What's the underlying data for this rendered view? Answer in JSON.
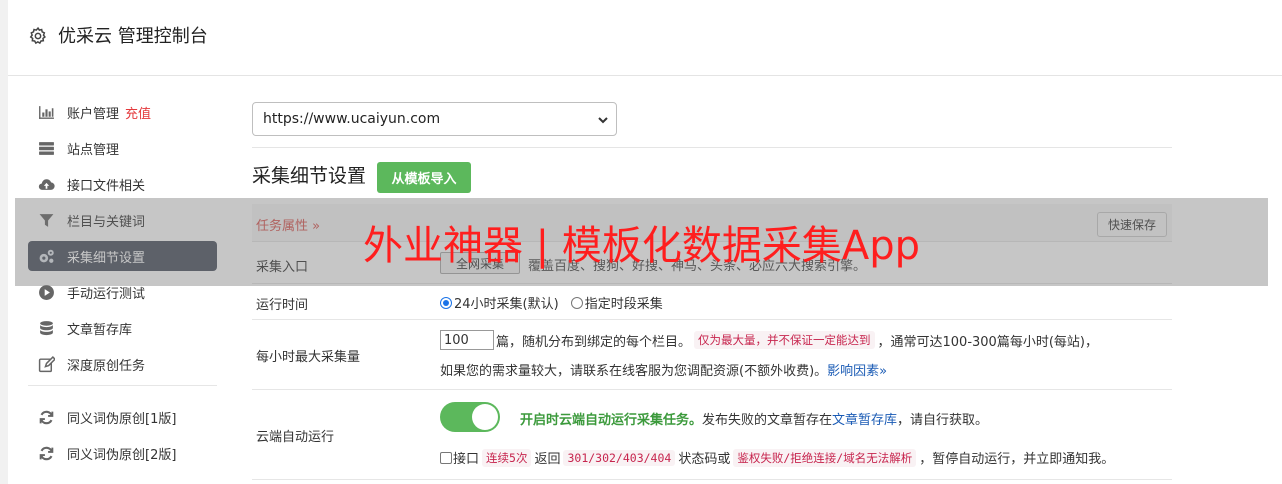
{
  "header": {
    "title": "优采云 管理控制台",
    "icon": "gear-icon"
  },
  "sidebar": {
    "items": [
      {
        "label": "账户管理",
        "extra": "充值",
        "icon": "bar-chart-icon"
      },
      {
        "label": "站点管理",
        "icon": "server-icon"
      },
      {
        "label": "接口文件相关",
        "icon": "cloud-upload-icon"
      },
      {
        "label": "栏目与关键词",
        "icon": "filter-icon"
      },
      {
        "label": "采集细节设置",
        "icon": "cogs-icon",
        "active": true
      },
      {
        "label": "手动运行测试",
        "icon": "play-circle-icon"
      },
      {
        "label": "文章暂存库",
        "icon": "database-icon"
      },
      {
        "label": "深度原创任务",
        "icon": "edit-icon"
      },
      {
        "label": "同义词伪原创[1版]",
        "icon": "refresh-icon"
      },
      {
        "label": "同义词伪原创[2版]",
        "icon": "refresh-icon"
      }
    ]
  },
  "site_select": {
    "value": "https://www.ucaiyun.com"
  },
  "section": {
    "title": "采集细节设置",
    "import_button": "从模板导入"
  },
  "task_row": {
    "label": "任务属性 »",
    "quick_save": "快速保存"
  },
  "entry_row": {
    "label": "采集入口",
    "button": "全网采集",
    "note": "覆盖百度、搜狗、好搜、神马、头条、必应六大搜索引擎。"
  },
  "runtime_row": {
    "label": "运行时间",
    "option1": "24小时采集(默认)",
    "option2": "指定时段采集"
  },
  "rate_row": {
    "label": "每小时最大采集量",
    "value": "100",
    "text1": "篇，随机分布到绑定的每个栏目。",
    "code": "仅为最大量，并不保证一定能达到",
    "text2": "，通常可达100-300篇每小时(每站)，",
    "line2": "如果您的需求量较大，请联系在线客服为您调配资源(不额外收费)。",
    "link": "影响因素",
    "link_suffix": "»"
  },
  "cloud_row": {
    "label": "云端自动运行",
    "green_text": "开启时云端自动运行采集任务。",
    "text_a": "发布失败的文章暂存在",
    "link": "文章暂存库",
    "text_b": "，请自行获取。",
    "l2_a": "接口",
    "code1": "连续5次",
    "l2_b": "返回",
    "code2": "301/302/403/404",
    "l2_c": "状态码或",
    "code3": "鉴权失败/拒绝连接/域名无法解析",
    "l2_d": "，暂停自动运行，并立即通知我。"
  },
  "overlay": {
    "text": "外业神器 | 模板化数据采集App"
  },
  "colors": {
    "accent_green": "#5cb85c",
    "active_nav": "#4a5160",
    "red": "#e4393c",
    "link_blue": "#1a5bb5"
  }
}
